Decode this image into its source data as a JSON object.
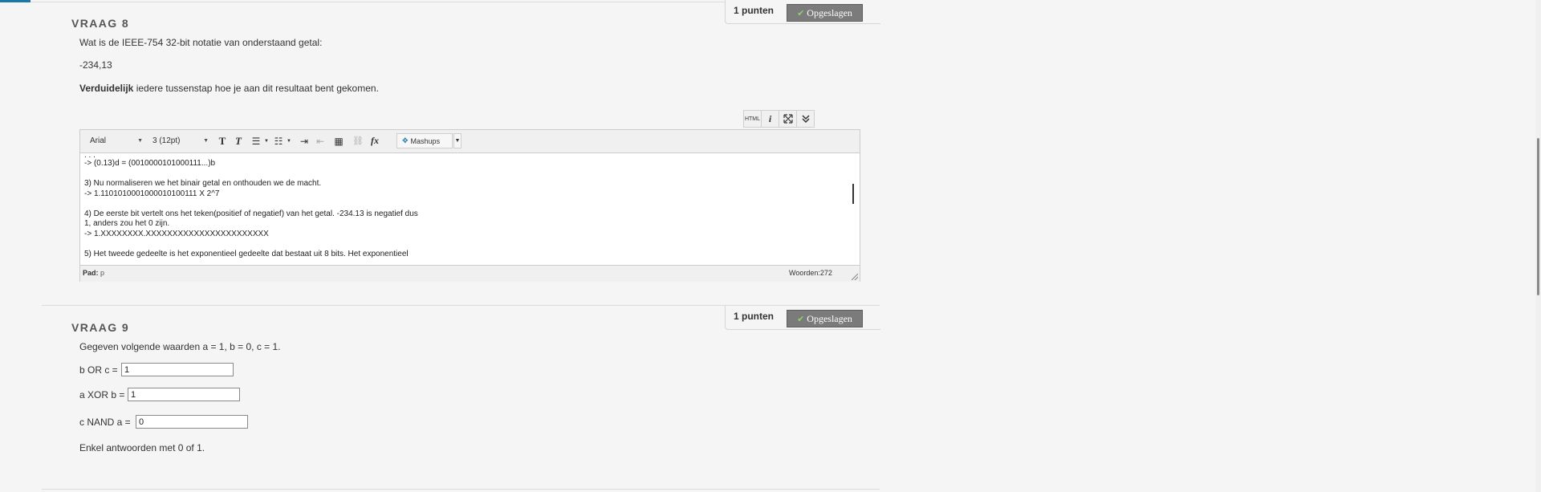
{
  "q8": {
    "title": "VRAAG 8",
    "points": "1 punten",
    "saved": "Opgeslagen",
    "prompt": "Wat is de IEEE-754 32-bit notatie van onderstaand getal:",
    "number": "-234,13",
    "instruction_bold": "Verduidelijk",
    "instruction_rest": " iedere tussenstap hoe je aan dit resultaat bent gekomen.",
    "editor": {
      "top_tools": [
        "HTML",
        "i",
        "expand-icon",
        "collapse-icon"
      ],
      "font_family": "Arial",
      "font_size": "3 (12pt)",
      "mashups": "Mashups",
      "lines": [
        ". . .",
        "-> (0.13)d = (0010000101000111...)b",
        "",
        "3) Nu normaliseren we het binair getal en onthouden we de macht.",
        " -> 1.1101010001000010100111 X 2^7",
        "",
        "4)  De eerste bit vertelt ons het teken(positief of negatief) van het getal. -234.13 is negatief dus",
        "1, anders zou het 0 zijn.",
        "-> 1.XXXXXXXX.XXXXXXXXXXXXXXXXXXXXXXX",
        "",
        "5) Het tweede gedeelte is het exponentieel gedeelte dat bestaat uit 8 bits. Het exponentieel"
      ],
      "path_label": "Pad:",
      "path_value": "p",
      "words": "Woorden:272"
    }
  },
  "q9": {
    "title": "VRAAG 9",
    "points": "1 punten",
    "saved": "Opgeslagen",
    "prompt": "Gegeven volgende waarden a = 1, b = 0, c = 1.",
    "fields": [
      {
        "label": "b OR c =",
        "value": "1"
      },
      {
        "label": "a XOR b =",
        "value": "1"
      },
      {
        "label": "c NAND a =",
        "value": "0"
      }
    ],
    "note": "Enkel antwoorden met 0 of 1."
  }
}
